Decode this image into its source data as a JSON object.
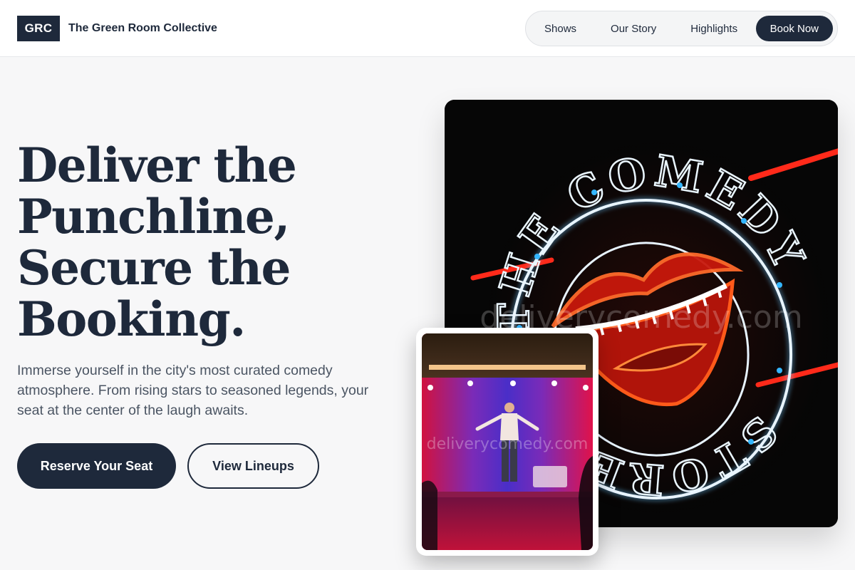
{
  "brand": {
    "logo_text": "GRC",
    "name": "The Green Room Collective"
  },
  "nav": {
    "items": [
      {
        "label": "Shows"
      },
      {
        "label": "Our Story"
      },
      {
        "label": "Highlights"
      }
    ],
    "cta_label": "Book Now"
  },
  "hero": {
    "title_lines": [
      "Deliver the",
      "Punchline,",
      "Secure the",
      "Booking."
    ],
    "subtitle": "Immerse yourself in the city's most curated comedy atmosphere. From rising stars to seasoned legends, your seat at the center of the laugh awaits.",
    "primary_button": "Reserve Your Seat",
    "secondary_button": "View Lineups"
  },
  "images": {
    "main": {
      "sign_text": "THE COMEDY STORE",
      "watermark": "deliverycomedy.com"
    },
    "inset": {
      "watermark": "deliverycomedy.com"
    }
  },
  "colors": {
    "primary": "#1e293b",
    "background": "#f7f7f8",
    "neon_red": "#ff2a1a",
    "neon_white": "#e8f4ff",
    "neon_blue": "#34b6ff"
  }
}
